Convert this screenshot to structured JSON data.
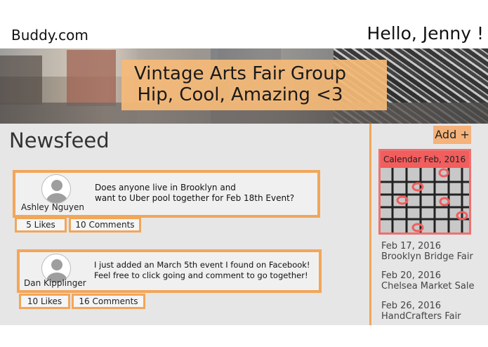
{
  "header": {
    "logo": "Buddy.com",
    "greeting": "Hello, Jenny !"
  },
  "banner": {
    "title": "Vintage Arts Fair Group",
    "subtitle": "Hip, Cool, Amazing <3"
  },
  "newsfeed": {
    "title": "Newsfeed",
    "posts": [
      {
        "author": "Ashley Nguyen",
        "text_line1": "Does anyone live in Brooklyn and",
        "text_line2": "want to Uber pool together for Feb 18th Event?",
        "likes": "5 Likes",
        "comments": "10 Comments"
      },
      {
        "author": "Dan Kipplinger",
        "text_line1": "I just added an March 5th event I found on Facebook!",
        "text_line2": "Feel free to click going and comment to go together!",
        "likes": "10 Likes",
        "comments": "16 Comments"
      }
    ]
  },
  "sidebar": {
    "add_label": "Add +",
    "calendar_title": "Calendar  Feb, 2016",
    "events": [
      {
        "date": "Feb 17, 2016",
        "name": "Brooklyn Bridge Fair"
      },
      {
        "date": "Feb 20, 2016",
        "name": "Chelsea Market Sale"
      },
      {
        "date": "Feb 26, 2016",
        "name": "HandCrafters Fair"
      }
    ]
  },
  "colors": {
    "accent": "#f2a659",
    "calendar_red": "#f25d5d",
    "panel_bg": "#e6e6e6"
  }
}
